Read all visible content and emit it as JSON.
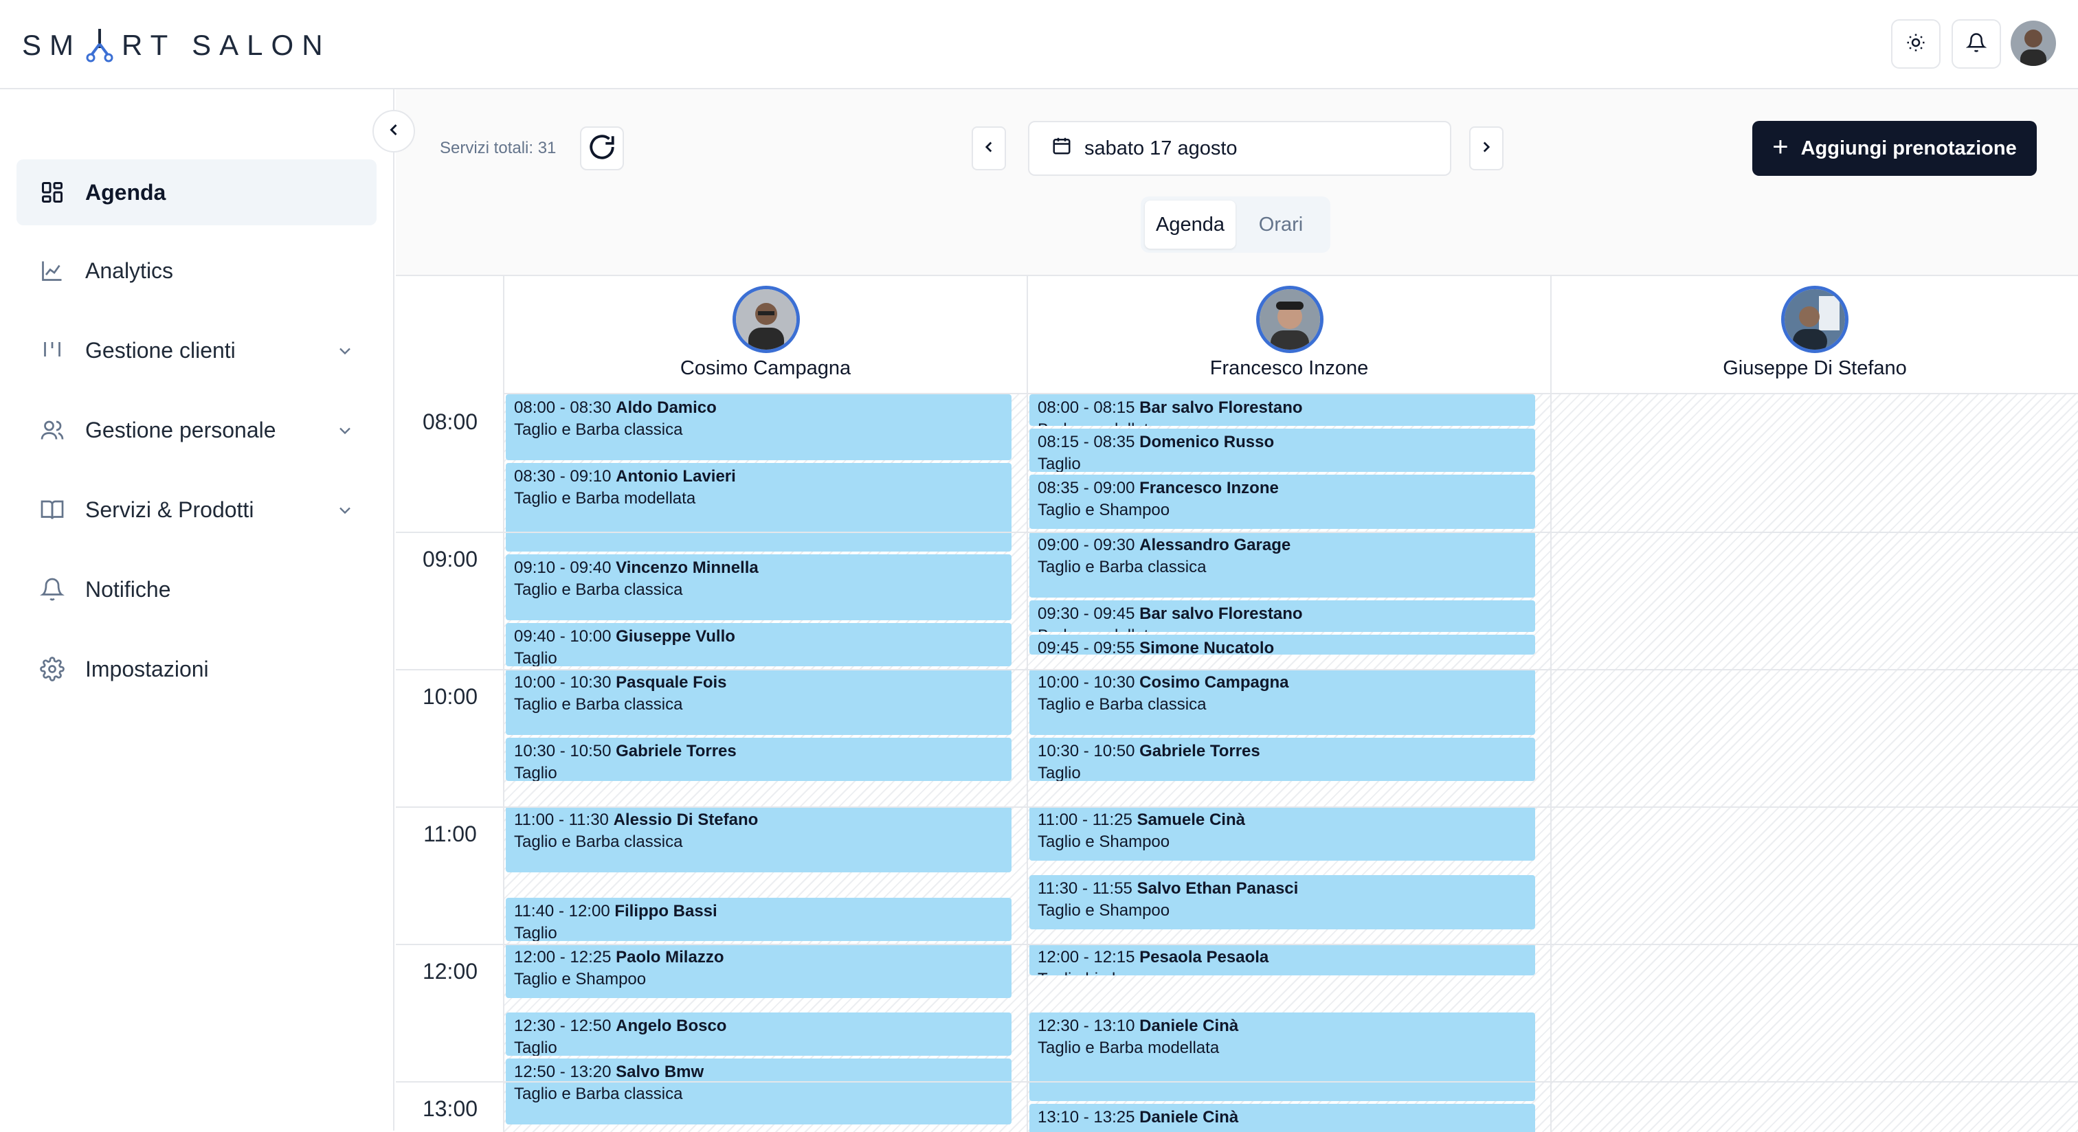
{
  "brand": {
    "logo_left": "SM",
    "logo_right": "RT SALON"
  },
  "header": {
    "theme_icon": "sun-icon",
    "notification_icon": "bell-icon"
  },
  "sidebar": {
    "items": [
      {
        "label": "Agenda",
        "icon": "grid-icon",
        "active": true
      },
      {
        "label": "Analytics",
        "icon": "chart-line-icon"
      },
      {
        "label": "Gestione clienti",
        "icon": "bars-icon"
      },
      {
        "label": "Gestione personale",
        "icon": "users-icon"
      },
      {
        "label": "Servizi & Prodotti",
        "icon": "book-icon"
      },
      {
        "label": "Notifiche",
        "icon": "bell-icon"
      },
      {
        "label": "Impostazioni",
        "icon": "gear-icon"
      }
    ]
  },
  "toolbar": {
    "services_total": "Servizi totali: 31",
    "date": "sabato 17 agosto",
    "add_button": "Aggiungi prenotazione",
    "tabs": [
      "Agenda",
      "Orari"
    ]
  },
  "times": [
    "08:00",
    "09:00",
    "10:00",
    "11:00",
    "12:00",
    "13:00"
  ],
  "staff": [
    {
      "name": "Cosimo Campagna",
      "appointments": [
        {
          "time": "08:00 - 08:30",
          "client": "Aldo Damico",
          "service": "Taglio e Barba classica",
          "start": "08:00",
          "end": "08:30"
        },
        {
          "time": "08:30 - 09:10",
          "client": "Antonio Lavieri",
          "service": "Taglio e Barba modellata",
          "start": "08:30",
          "end": "09:10"
        },
        {
          "time": "09:10 - 09:40",
          "client": "Vincenzo Minnella",
          "service": "Taglio e Barba classica",
          "start": "09:10",
          "end": "09:40"
        },
        {
          "time": "09:40 - 10:00",
          "client": "Giuseppe Vullo",
          "service": "Taglio",
          "start": "09:40",
          "end": "10:00"
        },
        {
          "time": "10:00 - 10:30",
          "client": "Pasquale Fois",
          "service": "Taglio e Barba classica",
          "start": "10:00",
          "end": "10:30"
        },
        {
          "time": "10:30 - 10:50",
          "client": "Gabriele Torres",
          "service": "Taglio",
          "start": "10:30",
          "end": "10:50"
        },
        {
          "time": "11:00 - 11:30",
          "client": "Alessio Di Stefano",
          "service": "Taglio e Barba classica",
          "start": "11:00",
          "end": "11:30"
        },
        {
          "time": "11:40 - 12:00",
          "client": "Filippo Bassi",
          "service": "Taglio",
          "start": "11:40",
          "end": "12:00"
        },
        {
          "time": "12:00 - 12:25",
          "client": "Paolo Milazzo",
          "service": "Taglio e Shampoo",
          "start": "12:00",
          "end": "12:25"
        },
        {
          "time": "12:30 - 12:50",
          "client": "Angelo Bosco",
          "service": "Taglio",
          "start": "12:30",
          "end": "12:50"
        },
        {
          "time": "12:50 - 13:20",
          "client": "Salvo Bmw",
          "service": "Taglio e Barba classica",
          "start": "12:50",
          "end": "13:20"
        }
      ]
    },
    {
      "name": "Francesco Inzone",
      "appointments": [
        {
          "time": "08:00 - 08:15",
          "client": "Bar salvo Florestano",
          "service": "Barba modellata",
          "start": "08:00",
          "end": "08:15"
        },
        {
          "time": "08:15 - 08:35",
          "client": "Domenico Russo",
          "service": "Taglio",
          "start": "08:15",
          "end": "08:35"
        },
        {
          "time": "08:35 - 09:00",
          "client": "Francesco Inzone",
          "service": "Taglio e Shampoo",
          "start": "08:35",
          "end": "09:00"
        },
        {
          "time": "09:00 - 09:30",
          "client": "Alessandro Garage",
          "service": "Taglio e Barba classica",
          "start": "09:00",
          "end": "09:30"
        },
        {
          "time": "09:30 - 09:45",
          "client": "Bar salvo Florestano",
          "service": "Barba modellata",
          "start": "09:30",
          "end": "09:45"
        },
        {
          "time": "09:45 - 09:55",
          "client": "Simone Nucatolo",
          "service": "",
          "start": "09:45",
          "end": "09:55"
        },
        {
          "time": "10:00 - 10:30",
          "client": "Cosimo Campagna",
          "service": "Taglio e Barba classica",
          "start": "10:00",
          "end": "10:30"
        },
        {
          "time": "10:30 - 10:50",
          "client": "Gabriele Torres",
          "service": "Taglio",
          "start": "10:30",
          "end": "10:50"
        },
        {
          "time": "11:00 - 11:25",
          "client": "Samuele Cinà",
          "service": "Taglio e Shampoo",
          "start": "11:00",
          "end": "11:25"
        },
        {
          "time": "11:30 - 11:55",
          "client": "Salvo Ethan Panasci",
          "service": "Taglio e Shampoo",
          "start": "11:30",
          "end": "11:55"
        },
        {
          "time": "12:00 - 12:15",
          "client": "Pesaola Pesaola",
          "service": "Taglio bimbo",
          "start": "12:00",
          "end": "12:15"
        },
        {
          "time": "12:30 - 13:10",
          "client": "Daniele Cinà",
          "service": "Taglio e Barba modellata",
          "start": "12:30",
          "end": "13:10"
        },
        {
          "time": "13:10 - 13:25",
          "client": "Daniele Cinà",
          "service": "",
          "start": "13:10",
          "end": "13:25"
        }
      ]
    },
    {
      "name": "Giuseppe Di Stefano",
      "appointments": []
    }
  ]
}
